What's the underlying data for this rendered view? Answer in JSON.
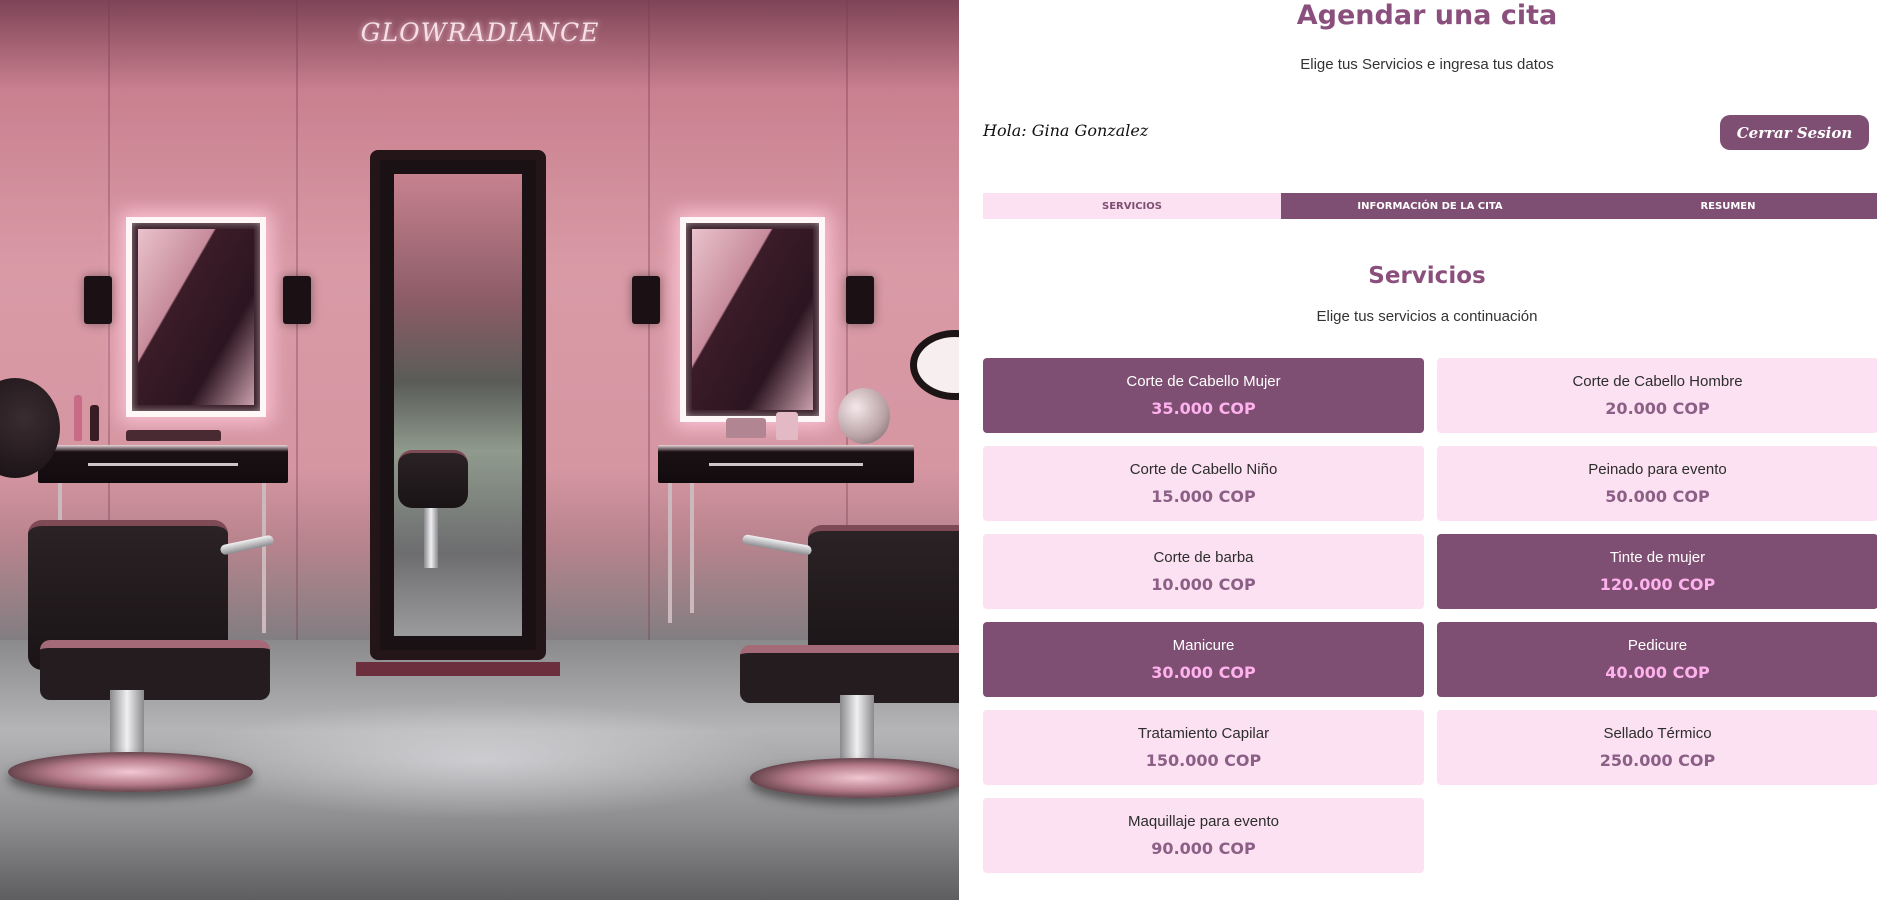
{
  "hero": {
    "brand": "GLOWRADIANCE"
  },
  "booking": {
    "title": "Agendar una cita",
    "subtitle": "Elige tus Servicios e ingresa tus datos",
    "greeting": "Hola: Gina Gonzalez",
    "logout_label": "Cerrar Sesion",
    "tabs": [
      {
        "label": "Servicios",
        "active": true
      },
      {
        "label": "Información de la cita",
        "active": false
      },
      {
        "label": "Resumen",
        "active": false
      }
    ],
    "services_title": "Servicios",
    "services_subtitle": "Elige tus servicios a continuación",
    "services": [
      {
        "name": "Corte de Cabello Mujer",
        "price": "35.000 COP",
        "selected": true
      },
      {
        "name": "Corte de Cabello Hombre",
        "price": "20.000 COP",
        "selected": false
      },
      {
        "name": "Corte de Cabello Niño",
        "price": "15.000 COP",
        "selected": false
      },
      {
        "name": "Peinado para evento",
        "price": "50.000 COP",
        "selected": false
      },
      {
        "name": "Corte de barba",
        "price": "10.000 COP",
        "selected": false
      },
      {
        "name": "Tinte de mujer",
        "price": "120.000 COP",
        "selected": true
      },
      {
        "name": "Manicure",
        "price": "30.000 COP",
        "selected": true
      },
      {
        "name": "Pedicure",
        "price": "40.000 COP",
        "selected": true
      },
      {
        "name": "Tratamiento Capilar",
        "price": "150.000 COP",
        "selected": false
      },
      {
        "name": "Sellado Térmico",
        "price": "250.000 COP",
        "selected": false
      },
      {
        "name": "Maquillaje para evento",
        "price": "90.000 COP",
        "selected": false
      }
    ]
  },
  "colors": {
    "primary": "#7e4f72",
    "accent_light": "#fbe1f1",
    "title": "#8b4f7d",
    "selected_price": "#ffb1ee"
  }
}
